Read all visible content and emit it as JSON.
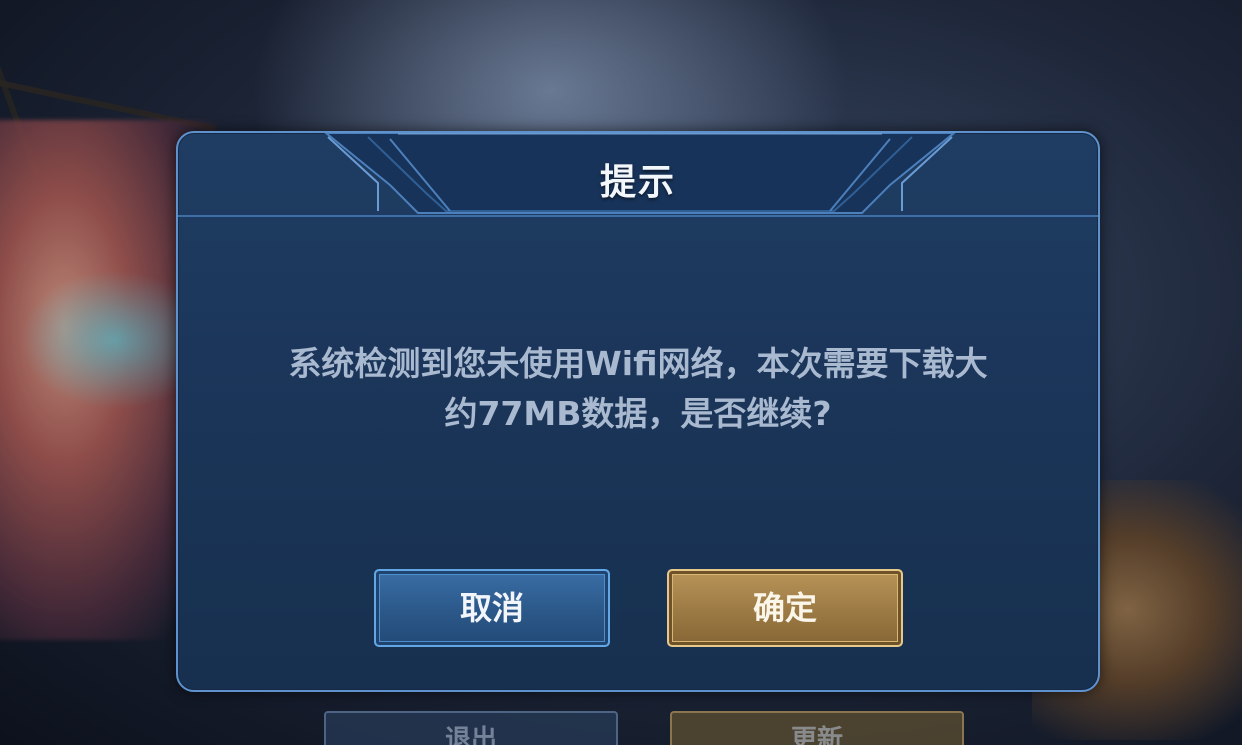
{
  "dialog": {
    "title": "提示",
    "message_line1": "系统检测到您未使用Wifi网络，本次需要下载大",
    "message_line2": "约77MB数据，是否继续?",
    "cancel_label": "取消",
    "ok_label": "确定"
  },
  "background": {
    "left_button_label": "退出",
    "right_button_label": "更新"
  },
  "colors": {
    "dialog_border": "#5f92cc",
    "dialog_bg": "#1b365a",
    "cancel_bg": "#2b5889",
    "ok_bg": "#9c7a44",
    "message_text": "#a9b9cf"
  },
  "icons": [
    "header-ornament-icon"
  ]
}
